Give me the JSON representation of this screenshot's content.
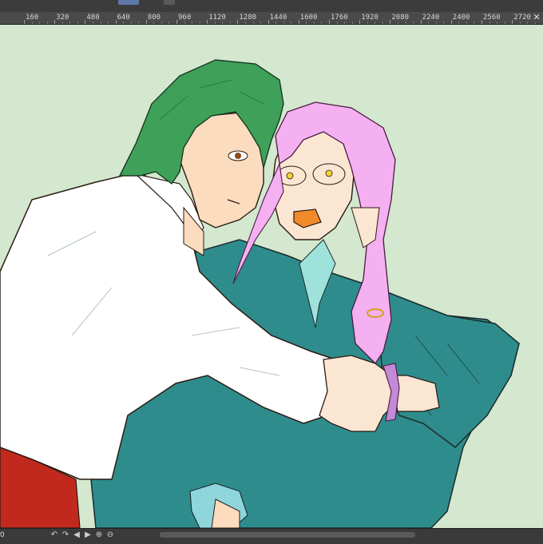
{
  "ruler": {
    "labels": [
      "160",
      "320",
      "480",
      "640",
      "800",
      "960",
      "1120",
      "1280",
      "1440",
      "1600",
      "1760",
      "1920",
      "2080",
      "2240",
      "2400",
      "2560",
      "2720"
    ],
    "close_glyph": "✕"
  },
  "bottom_bar": {
    "zoom_label": "0",
    "nav_icons": [
      "↶",
      "↷",
      "◀",
      "▶",
      "⊕",
      "⊖"
    ]
  },
  "colors": {
    "canvas_bg": "#d3e8cf",
    "ui_dark": "#3a3a3a",
    "ruler_bg": "#4a4a4a",
    "hair_green": "#3fa05a",
    "hair_pink": "#f4b0f0",
    "shirt_white": "#ffffff",
    "kimono_teal": "#2f8c8c",
    "skin": "#fbe0c6",
    "pants_red": "#c2291e"
  }
}
